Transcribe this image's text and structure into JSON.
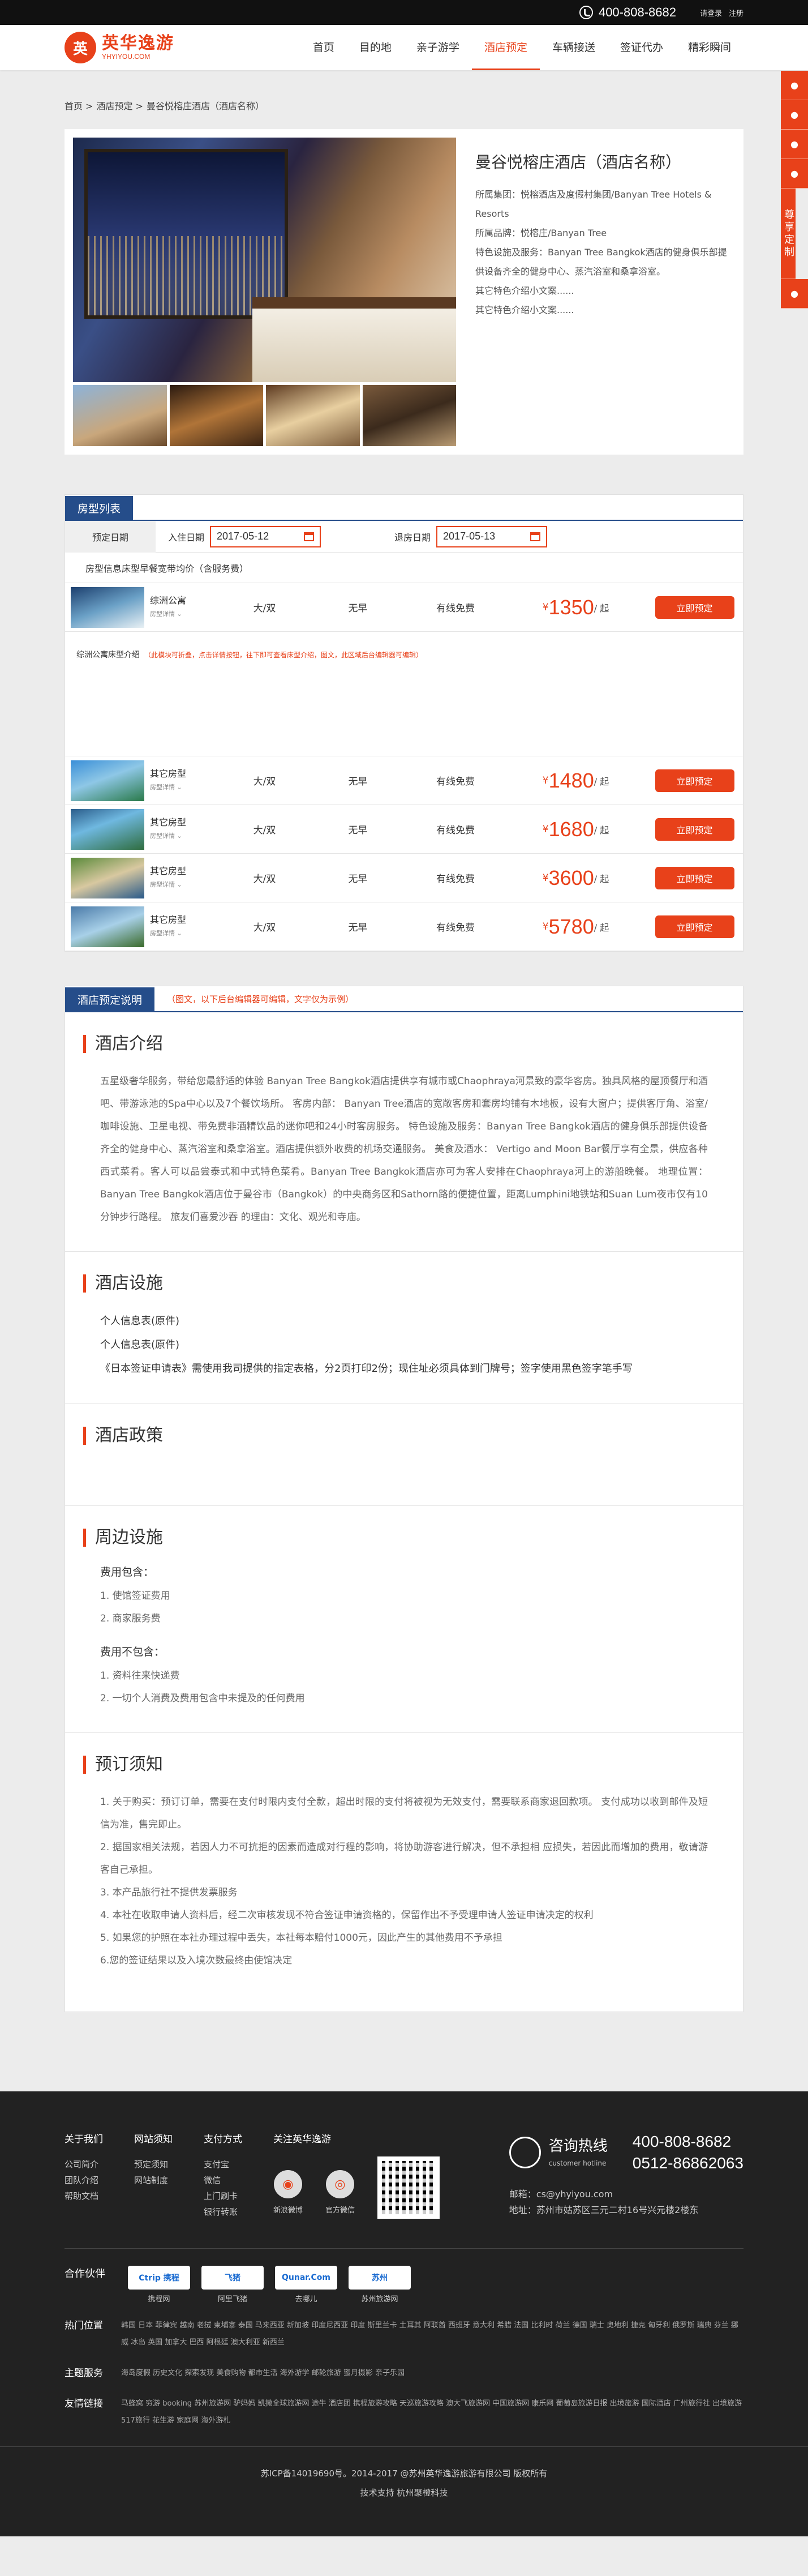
{
  "topbar": {
    "phone": "400-808-8682",
    "login": "请登录",
    "register": "注册"
  },
  "logo": {
    "cn": "英华逸游",
    "en": "YHYIYOU.COM",
    "mark": "英"
  },
  "nav": [
    "首页",
    "目的地",
    "亲子游学",
    "酒店预定",
    "车辆接送",
    "签证代办",
    "精彩瞬间"
  ],
  "nav_active": 3,
  "side": {
    "icons": [
      "service-icon",
      "user-icon",
      "weibo-icon",
      "wechat-icon",
      "thumb-icon"
    ],
    "custom": "尊享定制"
  },
  "breadcrumb": [
    "首页 >",
    "酒店预定 >",
    "曼谷悦榕庄酒店（酒店名称）"
  ],
  "hotel": {
    "name": "曼谷悦榕庄酒店（酒店名称）",
    "group": "所属集团：悦榕酒店及度假村集团/Banyan Tree Hotels & Resorts",
    "brand": "所属品牌：悦榕庄/Banyan Tree",
    "facility": "特色设施及服务：Banyan Tree Bangkok酒店的健身俱乐部提供设备齐全的健身中心、蒸汽浴室和桑拿浴室。",
    "intro1": "其它特色介绍小文案......",
    "intro2": "其它特色介绍小文案......"
  },
  "rooms": {
    "title": "房型列表",
    "date_label": "预定日期",
    "checkin_label": "入住日期",
    "checkin": "2017-05-12",
    "checkout_label": "退房日期",
    "checkout": "2017-05-13",
    "headers": [
      "房型信息",
      "床型",
      "早餐",
      "宽带",
      "均价（含服务费）"
    ],
    "detail_title": "综洲公寓床型介绍",
    "detail_note": "（此模块可折叠，点击详情按钮，往下即可查看床型介绍，图文，此区域后台编辑器可编辑）",
    "list": [
      {
        "name": "综洲公寓",
        "sub": "房型详情",
        "bed": "大/双",
        "breakfast": "无早",
        "net": "有线免费",
        "price": "1350",
        "unit": "/ 起",
        "btn": "立即预定"
      },
      {
        "name": "其它房型",
        "sub": "房型详情",
        "bed": "大/双",
        "breakfast": "无早",
        "net": "有线免费",
        "price": "1480",
        "unit": "/ 起",
        "btn": "立即预定"
      },
      {
        "name": "其它房型",
        "sub": "房型详情",
        "bed": "大/双",
        "breakfast": "无早",
        "net": "有线免费",
        "price": "1680",
        "unit": "/ 起",
        "btn": "立即预定"
      },
      {
        "name": "其它房型",
        "sub": "房型详情",
        "bed": "大/双",
        "breakfast": "无早",
        "net": "有线免费",
        "price": "3600",
        "unit": "/ 起",
        "btn": "立即预定"
      },
      {
        "name": "其它房型",
        "sub": "房型详情",
        "bed": "大/双",
        "breakfast": "无早",
        "net": "有线免费",
        "price": "5780",
        "unit": "/ 起",
        "btn": "立即预定"
      }
    ]
  },
  "desc": {
    "title": "酒店预定说明",
    "note": "（图文，以下后台编辑器可编辑，文字仅为示例）",
    "intro_h": "酒店介绍",
    "intro": "五星级奢华服务，带给您最舒适的体验 Banyan Tree Bangkok酒店提供享有城市或Chaophraya河景致的豪华客房。独具风格的屋顶餐厅和酒吧、带游泳池的Spa中心以及7个餐饮场所。 客房内部： Banyan Tree酒店的宽敞客房和套房均铺有木地板，设有大窗户；提供客厅角、浴室/咖啡设施、卫星电视、带免费非酒精饮品的迷你吧和24小时客房服务。 特色设施及服务：Banyan Tree Bangkok酒店的健身俱乐部提供设备齐全的健身中心、蒸汽浴室和桑拿浴室。酒店提供额外收费的机场交通服务。 美食及酒水： Vertigo and Moon Bar餐厅享有全景，供应各种西式菜肴。客人可以品尝泰式和中式特色菜肴。Banyan Tree Bangkok酒店亦可为客人安排在Chaophraya河上的游船晚餐。 地理位置： Banyan Tree Bangkok酒店位于曼谷市（Bangkok）的中央商务区和Sathorn路的便捷位置，距离Lumphini地铁站和Suan Lum夜市仅有10分钟步行路程。 旅友们喜爱沙吞 的理由：文化、观光和寺庙。",
    "fac_h": "酒店设施",
    "fac": [
      "个人信息表(原件)",
      "个人信息表(原件)",
      "《日本签证申请表》需使用我司提供的指定表格，分2页打印2份；现住址必须具体到门牌号；签字使用黑色签字笔手写"
    ],
    "policy_h": "酒店政策",
    "around_h": "周边设施",
    "inc_h": "费用包含：",
    "inc": [
      "1. 使馆签证费用",
      "2. 商家服务费"
    ],
    "exc_h": "费用不包含：",
    "exc": [
      "1. 资料往来快递费",
      "2. 一切个人消费及费用包含中未提及的任何费用"
    ],
    "notice_h": "预订须知",
    "notice": [
      "1. 关于购买：预订订单，需要在支付时限内支付全款，超出时限的支付将被视为无效支付，需要联系商家退回款项。 支付成功以收到邮件及短信为准，售完即止。",
      "2. 据国家相关法规，若因人力不可抗拒的因素而造成对行程的影响，将协助游客进行解决，但不承担相 应损失，若因此而增加的费用，敬请游客自己承担。",
      "3. 本产品旅行社不提供发票服务",
      "4. 本社在收取申请人资料后，经二次审核发现不符合签证申请资格的，保留作出不予受理申请人签证申请决定的权利",
      "5. 如果您的护照在本社办理过程中丢失，本社每本赔付1000元，因此产生的其他费用不予承担",
      "6.您的签证结果以及入境次数最终由使馆决定"
    ]
  },
  "footer": {
    "cols": [
      {
        "h": "关于我们",
        "items": [
          "公司简介",
          "团队介绍",
          "帮助文档"
        ]
      },
      {
        "h": "网站须知",
        "items": [
          "预定须知",
          "网站制度"
        ]
      },
      {
        "h": "支付方式",
        "items": [
          "支付宝",
          "微信",
          "上门刷卡",
          "银行转账"
        ]
      }
    ],
    "follow_h": "关注英华逸游",
    "weibo": "新浪微博",
    "wechat": "官方微信",
    "hotline_h": "咨询热线",
    "hotline_sub": "customer hotline",
    "hotline1": "400-808-8682",
    "hotline2": "0512-86862063",
    "email": "邮箱：cs@yhyiyou.com",
    "addr": "地址：苏州市姑苏区三元二村16号兴元楼2楼东",
    "partners_h": "合作伙伴",
    "partners": [
      {
        "logo": "Ctrip 携程",
        "name": "携程网"
      },
      {
        "logo": "飞猪",
        "name": "阿里飞猪"
      },
      {
        "logo": "Qunar.Com",
        "name": "去哪儿"
      },
      {
        "logo": "苏州",
        "name": "苏州旅游网"
      }
    ],
    "hot_h": "热门位置",
    "hot": "韩国 日本 菲律宾 越南 老挝 柬埔寨 泰国 马来西亚 新加坡 印度尼西亚 印度 斯里兰卡 土耳其 阿联酋 西班牙 意大利 希腊 法国 比利时 荷兰 德国 瑞士 奥地利 捷克 匈牙利 俄罗斯 瑞典 芬兰 挪威 冰岛 英国 加拿大 巴西 阿根廷 澳大利亚 新西兰",
    "theme_h": "主题服务",
    "theme": "海岛度假 历史文化 探索发现 美食购物 都市生活 海外游学 邮轮旅游 蜜月摄影 亲子乐园",
    "links_h": "友情链接",
    "links": "马蜂窝 穷游 booking 苏州旅游网 驴妈妈 凯撒全球旅游网 途牛 酒店团 携程旅游攻略 天巡旅游攻略 澳大飞旅游网 中国旅游网 康乐网 葡萄岛旅游日报 出境旅游 国际酒店 广州旅行社 出境旅游 517旅行 花生游 家庭网 海外游札",
    "icp": "苏ICP备14019690号。2014-2017 @苏州英华逸游旅游有限公司 版权所有",
    "tech": "技术支持 杭州聚橙科技"
  }
}
